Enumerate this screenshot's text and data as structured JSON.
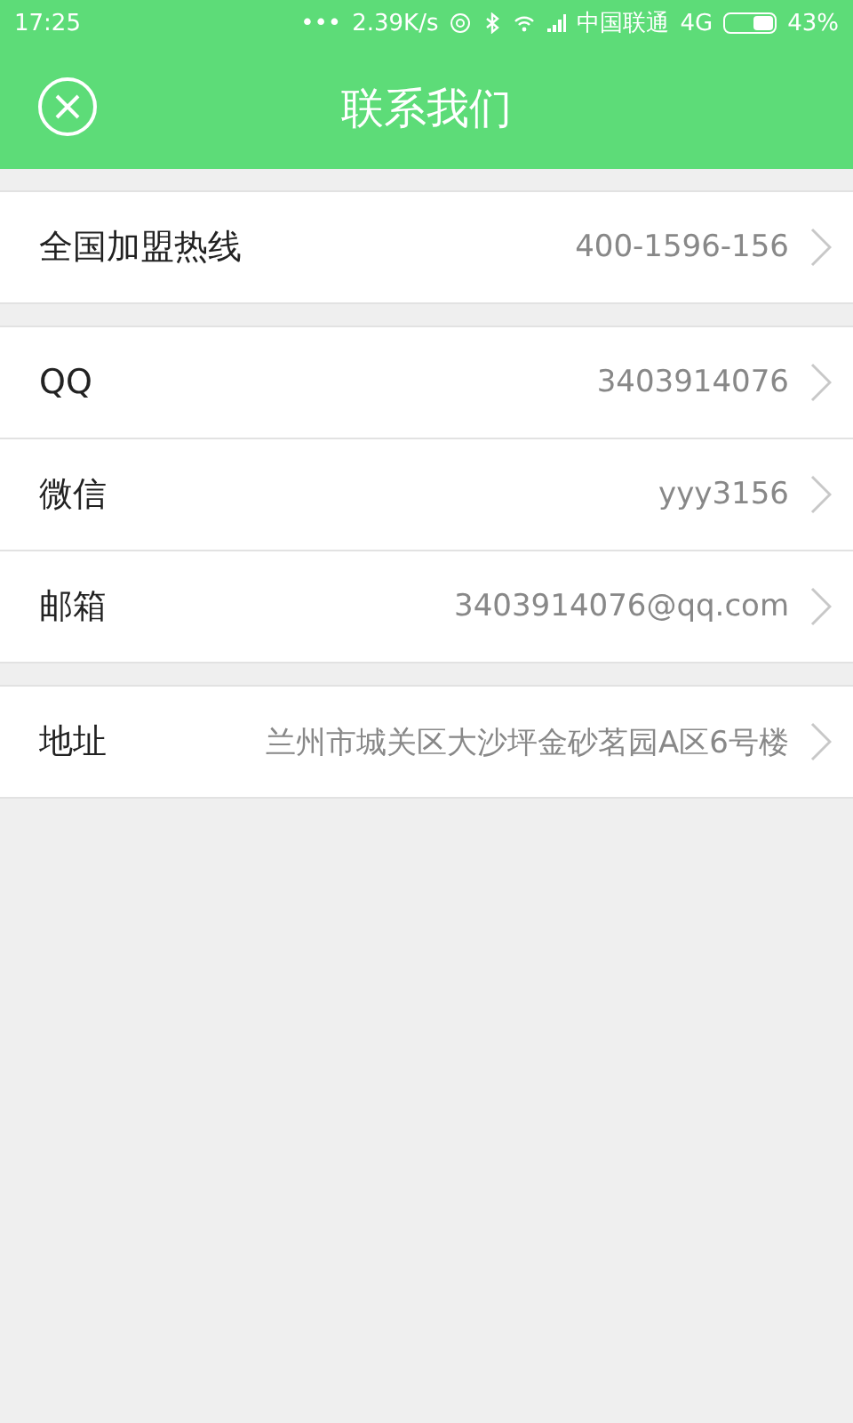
{
  "status_bar": {
    "time": "17:25",
    "dots": "•••",
    "speed": "2.39K/s",
    "carrier": "中国联通",
    "network": "4G",
    "battery_text": "43%",
    "battery": {
      "level": 0.43
    }
  },
  "header": {
    "title": "联系我们"
  },
  "groups": [
    {
      "items": [
        {
          "label": "全国加盟热线",
          "value": "400-1596-156"
        }
      ]
    },
    {
      "items": [
        {
          "label": "QQ",
          "value": "3403914076"
        },
        {
          "label": "微信",
          "value": "yyy3156"
        },
        {
          "label": "邮箱",
          "value": "3403914076@qq.com"
        }
      ]
    },
    {
      "items": [
        {
          "label": "地址",
          "value": "兰州市城关区大沙坪金砂茗园A区6号楼"
        }
      ]
    }
  ]
}
